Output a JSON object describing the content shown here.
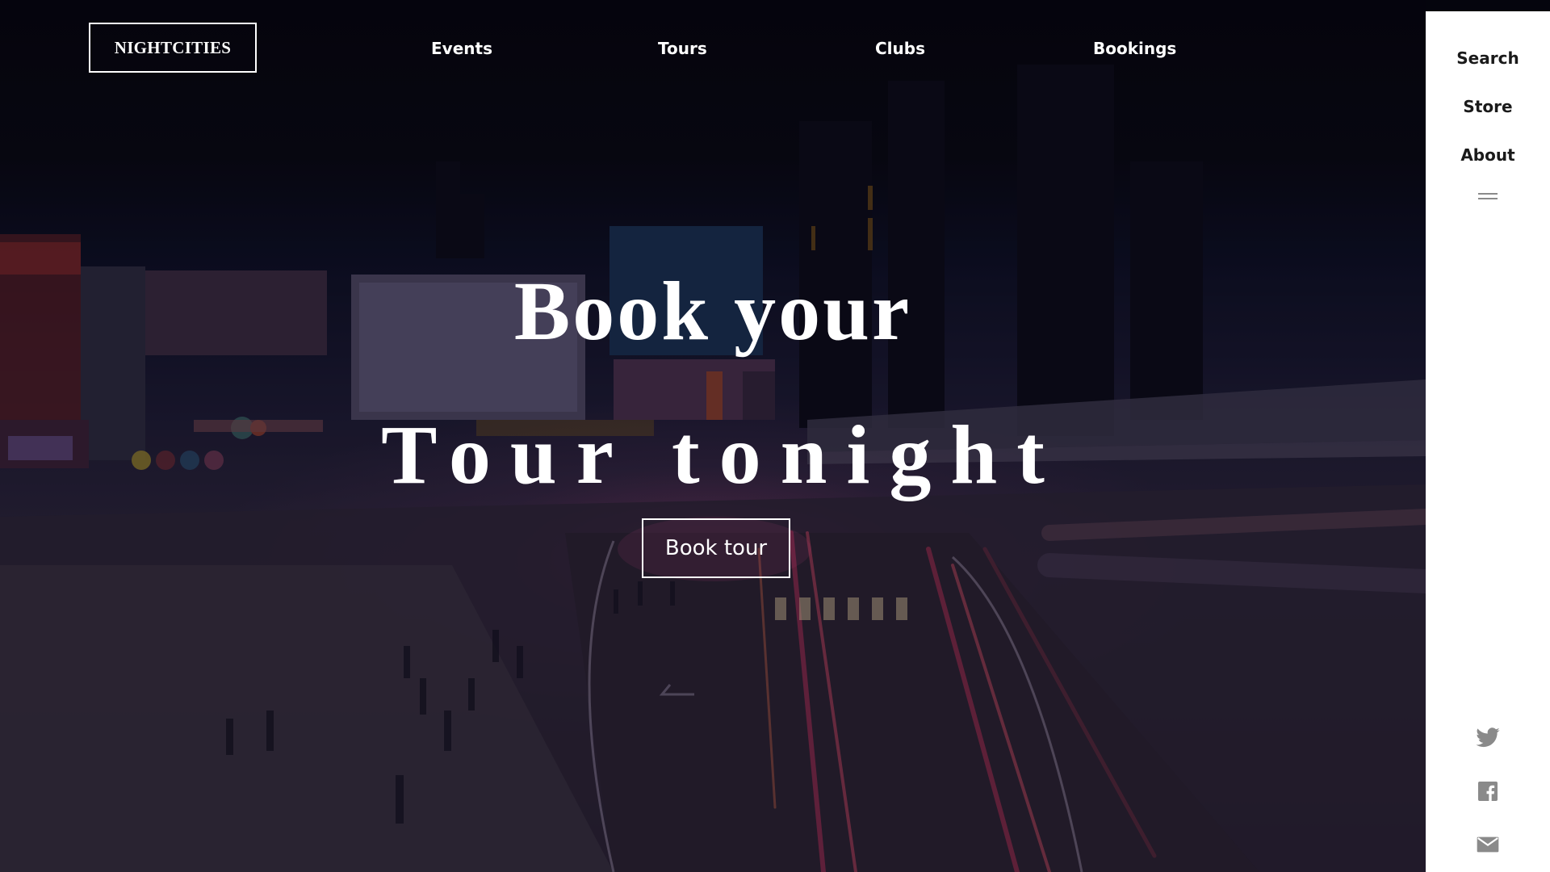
{
  "brand": {
    "logo_text": "NIGHTCITIES"
  },
  "nav": {
    "items": [
      {
        "label": "Events"
      },
      {
        "label": "Tours"
      },
      {
        "label": "Clubs"
      },
      {
        "label": "Bookings"
      }
    ]
  },
  "hero": {
    "title_line1": "Book your",
    "title_line2": "Tour tonight",
    "cta_label": "Book tour",
    "background_image": "night-city-street-image"
  },
  "sidebar": {
    "items": [
      {
        "label": "Search"
      },
      {
        "label": "Store"
      },
      {
        "label": "About"
      }
    ],
    "menu_icon": "hamburger-menu-icon",
    "social": [
      {
        "icon": "twitter-icon"
      },
      {
        "icon": "facebook-icon"
      },
      {
        "icon": "mail-icon"
      }
    ]
  },
  "colors": {
    "hero_overlay": "#0a0616",
    "text_primary": "#ffffff",
    "sidebar_background": "#ffffff",
    "sidebar_text": "#1a1a1a",
    "icon_gray": "#8a8a8a"
  }
}
